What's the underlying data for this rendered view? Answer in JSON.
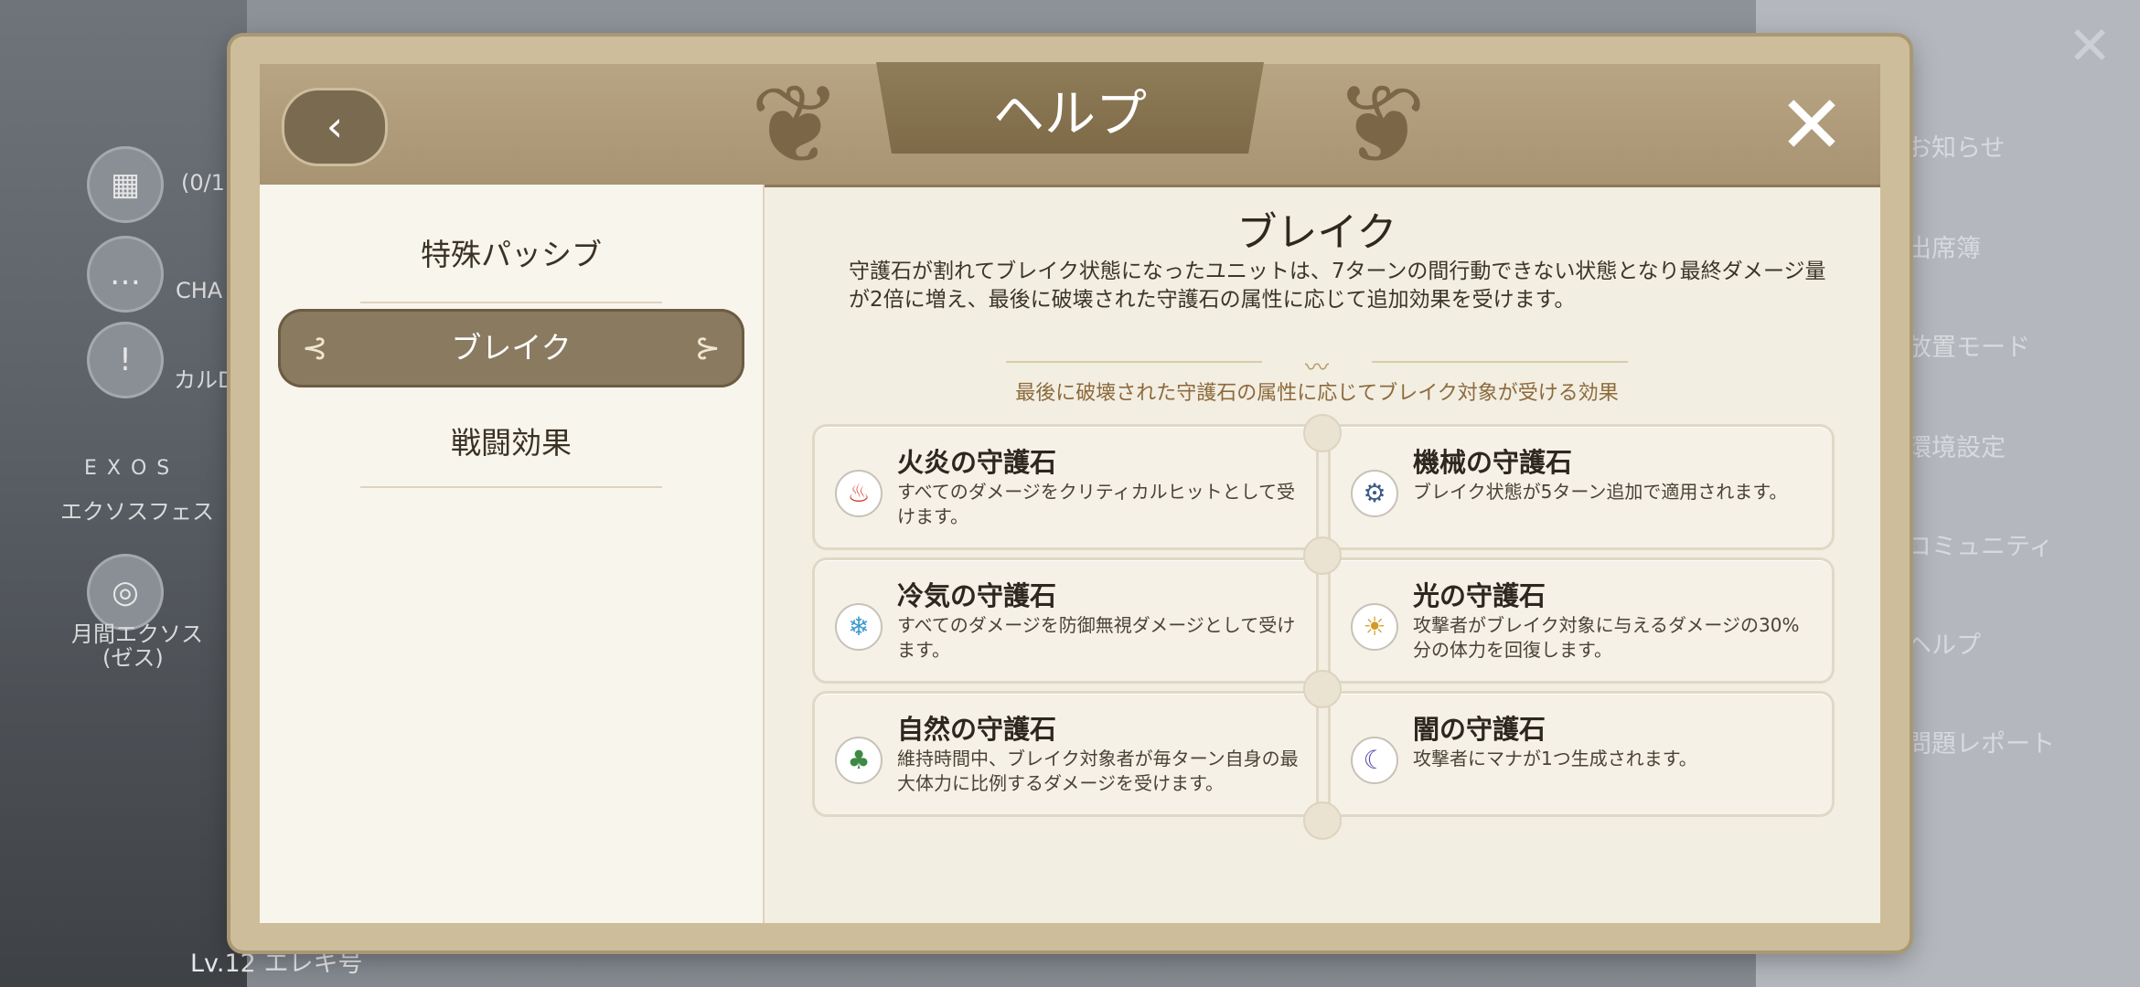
{
  "background": {
    "left_labels": [
      "(0/1",
      "CHA",
      "カルD",
      "エクソスフェス",
      "月間エクソス",
      "(ゼス)"
    ],
    "right_menu": [
      "お知らせ",
      "出席簿",
      "放置モード",
      "環境設定",
      "コミュニティ",
      "ヘルプ",
      "問題レポート"
    ],
    "level_text": "Lv.12 エレキ号",
    "exos_text": "E X O S"
  },
  "dialog": {
    "title": "ヘルプ",
    "back_icon": "chevron-left-icon",
    "close_icon": "close-icon"
  },
  "sidebar": {
    "items": [
      {
        "label": "特殊パッシブ",
        "active": false
      },
      {
        "label": "ブレイク",
        "active": true
      },
      {
        "label": "戦闘効果",
        "active": false
      }
    ]
  },
  "content": {
    "title": "ブレイク",
    "description": "守護石が割れてブレイク状態になったユニットは、7ターンの間行動できない状態となり最終ダメージ量が2倍に増え、最後に破壊された守護石の属性に応じて追加効果を受けます。",
    "subtitle": "最後に破壊された守護石の属性に応じてブレイク対象が受ける効果",
    "cards": [
      {
        "title": "火炎の守護石",
        "text": "すべてのダメージをクリティカルヒットとして受けます。",
        "icon": "fire-icon",
        "color": "#d2412f"
      },
      {
        "title": "機械の守護石",
        "text": "ブレイク状態が5ターン追加で適用されます。",
        "icon": "gear-icon",
        "color": "#3f5c8a"
      },
      {
        "title": "冷気の守護石",
        "text": "すべてのダメージを防御無視ダメージとして受けます。",
        "icon": "snowflake-icon",
        "color": "#3f9bd0"
      },
      {
        "title": "光の守護石",
        "text": "攻撃者がブレイク対象に与えるダメージの30%分の体力を回復します。",
        "icon": "sun-icon",
        "color": "#d39a23"
      },
      {
        "title": "自然の守護石",
        "text": "維持時間中、ブレイク対象者が毎ターン自身の最大体力に比例するダメージを受けます。",
        "icon": "tree-icon",
        "color": "#3e8a44"
      },
      {
        "title": "闇の守護石",
        "text": "攻撃者にマナが1つ生成されます。",
        "icon": "moon-icon",
        "color": "#5a4aa6"
      }
    ]
  }
}
